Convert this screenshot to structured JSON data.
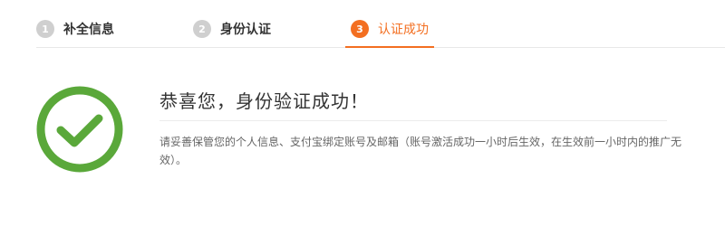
{
  "steps": [
    {
      "number": "1",
      "label": "补全信息",
      "state": "inactive"
    },
    {
      "number": "2",
      "label": "身份认证",
      "state": "inactive"
    },
    {
      "number": "3",
      "label": "认证成功",
      "state": "active"
    }
  ],
  "result": {
    "title": "恭喜您，身份验证成功！",
    "description": "请妥善保管您的个人信息、支付宝绑定账号及邮箱（账号激活成功一小时后生效，在生效前一小时内的推广无效）。"
  },
  "colors": {
    "accent": "#f36f21",
    "success": "#5aa83a",
    "inactive_step": "#cfcfcf"
  },
  "icons": {
    "success": "check-circle-icon"
  }
}
